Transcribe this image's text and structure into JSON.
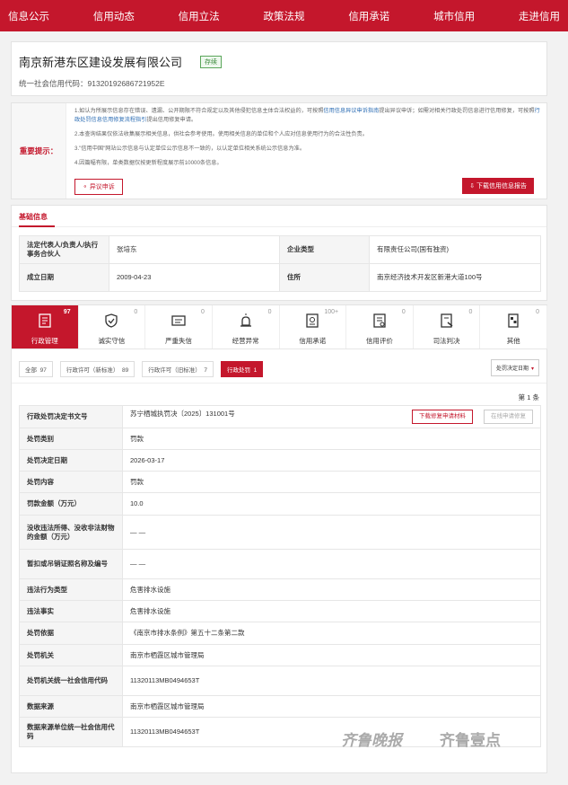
{
  "nav": [
    "信息公示",
    "信用动态",
    "信用立法",
    "政策法规",
    "信用承诺",
    "城市信用",
    "走进信用"
  ],
  "company": {
    "name": "南京新港东区建设发展有限公司",
    "status": "存续",
    "code_label": "统一社会信用代码：",
    "code_value": "91320192686721952E"
  },
  "notice": {
    "label": "重要提示：",
    "line1a": "1.如认为所展示信息存在错误、遗漏、公开期限不符合规定以及其他侵犯信息主体合法权益的，可按照",
    "line1link1": "信用信息异议申诉指南",
    "line1b": "提出异议申诉；如需对相关行政处罚信息进行信用修复，可按照",
    "line1link2": "行政处罚信息信用修复流程指引",
    "line1c": "提出信用修复申请。",
    "line2": "2.本查询结果仅依法收集展示相关信息，供社会参考使用。使用相关信息的单位和个人应对信息使用行为的合法性负责。",
    "line3": "3.\"信用中国\"网站公示信息与认定单位公示信息不一致的，以认定单位相关系统公示信息为准。",
    "line4": "4.因篇幅有限，单类数据仅按更新程度展示前10000条信息。",
    "objection_btn": "异议申诉",
    "download_btn": "下载信用信息报告"
  },
  "basic": {
    "title": "基础信息",
    "rows": [
      {
        "k1": "法定代表人/负责人/执行事务合伙人",
        "v1": "张培东",
        "k2": "企业类型",
        "v2": "有限责任公司(国有独资)"
      },
      {
        "k1": "成立日期",
        "v1": "2009-04-23",
        "k2": "住所",
        "v2": "南京经济技术开发区新港大道100号"
      }
    ]
  },
  "tabs": [
    {
      "label": "行政管理",
      "count": "97",
      "icon": "admin-doc-icon"
    },
    {
      "label": "诚实守信",
      "count": "0",
      "icon": "shield-check-icon"
    },
    {
      "label": "严重失信",
      "count": "0",
      "icon": "id-card-icon"
    },
    {
      "label": "经营异常",
      "count": "0",
      "icon": "alarm-icon"
    },
    {
      "label": "信用承诺",
      "count": "100+",
      "icon": "certificate-icon"
    },
    {
      "label": "信用评价",
      "count": "0",
      "icon": "evaluation-doc-icon"
    },
    {
      "label": "司法判决",
      "count": "0",
      "icon": "gavel-doc-icon"
    },
    {
      "label": "其他",
      "count": "0",
      "icon": "other-icon"
    }
  ],
  "filters": [
    {
      "label": "全部",
      "count": "97"
    },
    {
      "label": "行政许可（新标准）",
      "count": "89"
    },
    {
      "label": "行政许可（旧标准）",
      "count": "7"
    },
    {
      "label": "行政处罚",
      "count": "1"
    }
  ],
  "sort_label": "处罚决定日期",
  "page_label": "第 1 条",
  "detail": {
    "download_fix_btn": "下载修复申请材料",
    "online_fix_btn": "在线申请修复",
    "rows": [
      {
        "k": "行政处罚决定书文号",
        "v": "苏宁栖城执罚决〔2025〕131001号"
      },
      {
        "k": "处罚类别",
        "v": "罚款"
      },
      {
        "k": "处罚决定日期",
        "v": "2026-03-17"
      },
      {
        "k": "处罚内容",
        "v": "罚款"
      },
      {
        "k": "罚款金额（万元）",
        "v": "10.0"
      },
      {
        "k": "没收违法所得、没收非法财物的金额（万元）",
        "v": "— —"
      },
      {
        "k": "暂扣或吊销证照名称及编号",
        "v": "— —"
      },
      {
        "k": "违法行为类型",
        "v": "危害排水设施"
      },
      {
        "k": "违法事实",
        "v": "危害排水设施"
      },
      {
        "k": "处罚依据",
        "v": "《南京市排水条例》第五十二条第二款"
      },
      {
        "k": "处罚机关",
        "v": "南京市栖霞区城市管理局"
      },
      {
        "k": "处罚机关统一社会信用代码",
        "v": "11320113MB0494653T"
      },
      {
        "k": "数据来源",
        "v": "南京市栖霞区城市管理局"
      },
      {
        "k": "数据来源单位统一社会信用代码",
        "v": "11320113MB0494653T"
      }
    ]
  },
  "watermark": {
    "left": "齐鲁晚报",
    "right": "齐鲁壹点"
  }
}
